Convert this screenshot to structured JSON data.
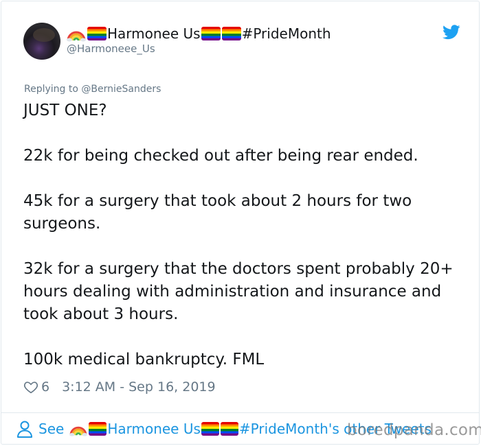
{
  "tweet": {
    "display_name_prefix": "Harmonee Us",
    "display_name_suffix": "#PrideMonth",
    "handle": "@Harmoneee_Us",
    "replying_to": "Replying to @BernieSanders",
    "body": "JUST ONE?\n\n22k for being checked out after being rear ended.\n\n45k for a surgery that took about 2 hours for two surgeons.\n\n32k for a surgery that the doctors spent probably 20+ hours dealing with administration and insurance and took about 3 hours.\n\n100k medical bankruptcy. FML",
    "likes": "6",
    "timestamp": "3:12 AM - Sep 16, 2019"
  },
  "footer": {
    "see_label": "See",
    "name": "Harmonee Us",
    "suffix": "#PrideMonth's other Tweets"
  },
  "watermark": "boredpanda.com",
  "icons": {
    "brand": "twitter-bird-icon",
    "like": "heart-icon",
    "profile": "person-icon",
    "emoji_rainbow": "rainbow-emoji",
    "emoji_flag": "rainbow-flag-emoji"
  },
  "colors": {
    "twitter_blue": "#1da1f2",
    "link_blue": "#1b95e0",
    "muted_gray": "#657786",
    "text": "#14171a",
    "border": "#e1e8ed"
  }
}
